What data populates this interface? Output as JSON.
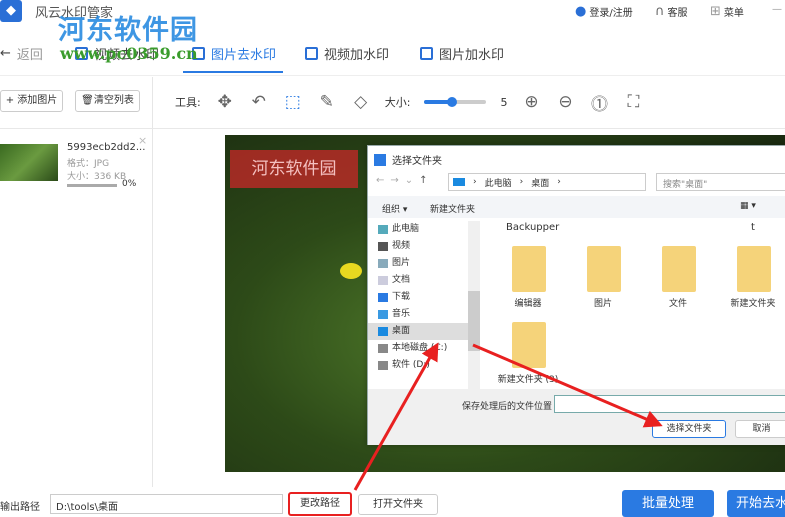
{
  "app": {
    "title": "风云水印管家",
    "login": "登录/注册",
    "service": "客服",
    "menu": "菜单",
    "minimize": "—"
  },
  "watermark": {
    "site": "河东软件园",
    "url": "www.pc0359.cn"
  },
  "nav": {
    "back": "返回",
    "tabs": [
      {
        "label": "视频去水印"
      },
      {
        "label": "图片去水印",
        "active": true
      },
      {
        "label": "视频加水印"
      },
      {
        "label": "图片加水印"
      }
    ]
  },
  "left": {
    "add": "+ 添加图片",
    "clear": "清空列表",
    "file": {
      "name": "5993ecb2dd2...",
      "format": "格式：JPG",
      "size": "大小：336 KB",
      "progress": "0%",
      "progress_value": 0
    }
  },
  "toolbar": {
    "tools_label": "工具:",
    "size_label": "大小:",
    "size_value": "5",
    "size_fraction": 0.45
  },
  "canvas": {
    "watermark_text": "河东软件园"
  },
  "dialog": {
    "title": "选择文件夹",
    "path": [
      "此电脑",
      "桌面"
    ],
    "search_placeholder": "搜索\"桌面\"",
    "organize": "组织 ▾",
    "new_folder": "新建文件夹",
    "tree": [
      "此电脑",
      "视频",
      "图片",
      "文档",
      "下载",
      "音乐",
      "桌面",
      "本地磁盘 (C:)",
      "软件 (D:)"
    ],
    "top_labels": [
      "Backupper",
      "t"
    ],
    "folders": [
      "编辑器",
      "图片",
      "文件",
      "新建文件夹",
      "新建文件夹 (3)"
    ],
    "location_label": "保存处理后的文件位置",
    "location_value": "",
    "select": "选择文件夹",
    "cancel": "取消"
  },
  "bottom": {
    "output_label": "输出路径",
    "output_value": "D:\\tools\\桌面",
    "change": "更改路径",
    "open": "打开文件夹",
    "batch": "批量处理",
    "start": "开始去水"
  },
  "colors": {
    "accent": "#2a7ae2",
    "annotation": "#e82020"
  }
}
